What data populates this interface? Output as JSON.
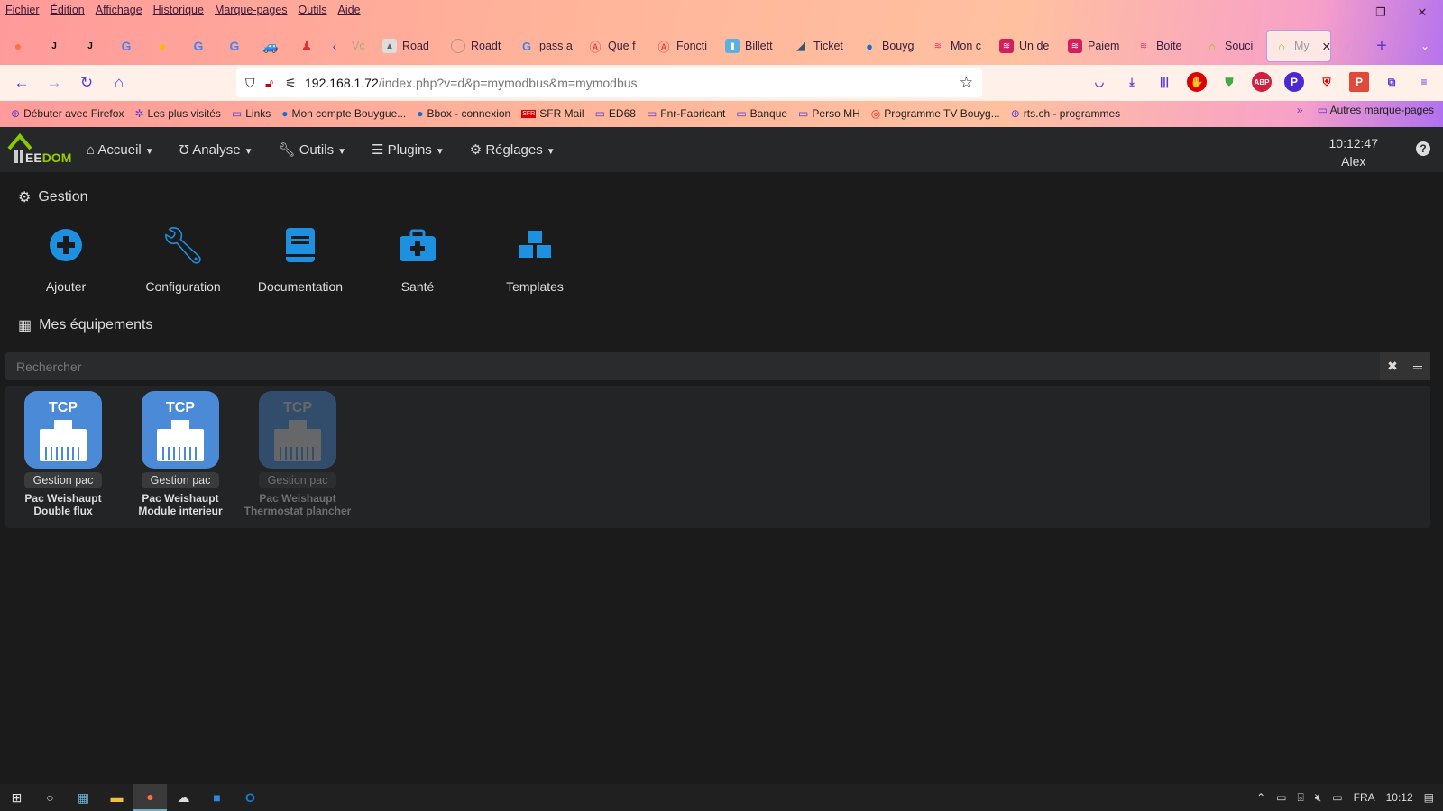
{
  "browser": {
    "menu": [
      "Fichier",
      "Édition",
      "Affichage",
      "Historique",
      "Marque-pages",
      "Outils",
      "Aide"
    ],
    "tabs": [
      {
        "label": "Vc",
        "icon": "chevron"
      },
      {
        "label": "Road",
        "icon": "road"
      },
      {
        "label": "Roadt",
        "icon": "fingerprint"
      },
      {
        "label": "pass a",
        "icon": "google"
      },
      {
        "label": "Que f",
        "icon": "brand-a"
      },
      {
        "label": "Foncti",
        "icon": "brand-a"
      },
      {
        "label": "Billett",
        "icon": "billet"
      },
      {
        "label": "Ticket",
        "icon": "ticket"
      },
      {
        "label": "Bouyg",
        "icon": "bouygues"
      },
      {
        "label": "Mon c",
        "icon": "wave"
      },
      {
        "label": "Un de",
        "icon": "wave"
      },
      {
        "label": "Paiem",
        "icon": "wave"
      },
      {
        "label": "Boite",
        "icon": "wave"
      },
      {
        "label": "Souci",
        "icon": "jeedom"
      },
      {
        "label": "My",
        "icon": "jeedom",
        "active": true
      }
    ],
    "url_host": "192.168.1.72",
    "url_path": "/index.php?v=d&p=mymodbus&m=mymodbus",
    "bookmarks": [
      "Débuter avec Firefox",
      "Les plus visités",
      "Links",
      "Mon compte Bouygue...",
      "Bbox - connexion",
      "SFR Mail",
      "ED68",
      "Fnr-Fabricant",
      "Banque",
      "Perso MH",
      "Programme TV Bouyg...",
      "rts.ch - programmes"
    ],
    "other_bookmarks": "Autres marque-pages"
  },
  "jeedom": {
    "logo": "EEDOM",
    "menu": [
      "Accueil",
      "Analyse",
      "Outils",
      "Plugins",
      "Réglages"
    ],
    "time": "10:12:47",
    "user": "Alex",
    "help": "?"
  },
  "gestion": {
    "title": "Gestion",
    "actions": [
      "Ajouter",
      "Configuration",
      "Documentation",
      "Santé",
      "Templates"
    ]
  },
  "equipements": {
    "title": "Mes équipements",
    "search_placeholder": "Rechercher",
    "items": [
      {
        "icon_text": "TCP",
        "category": "Gestion pac",
        "name1": "Pac Weishaupt",
        "name2": "Double flux",
        "enabled": true
      },
      {
        "icon_text": "TCP",
        "category": "Gestion pac",
        "name1": "Pac Weishaupt",
        "name2": "Module interieur",
        "enabled": true
      },
      {
        "icon_text": "TCP",
        "category": "Gestion pac",
        "name1": "Pac Weishaupt",
        "name2": "Thermostat plancher",
        "enabled": false
      }
    ]
  },
  "taskbar": {
    "lang": "FRA",
    "time": "10:12"
  }
}
